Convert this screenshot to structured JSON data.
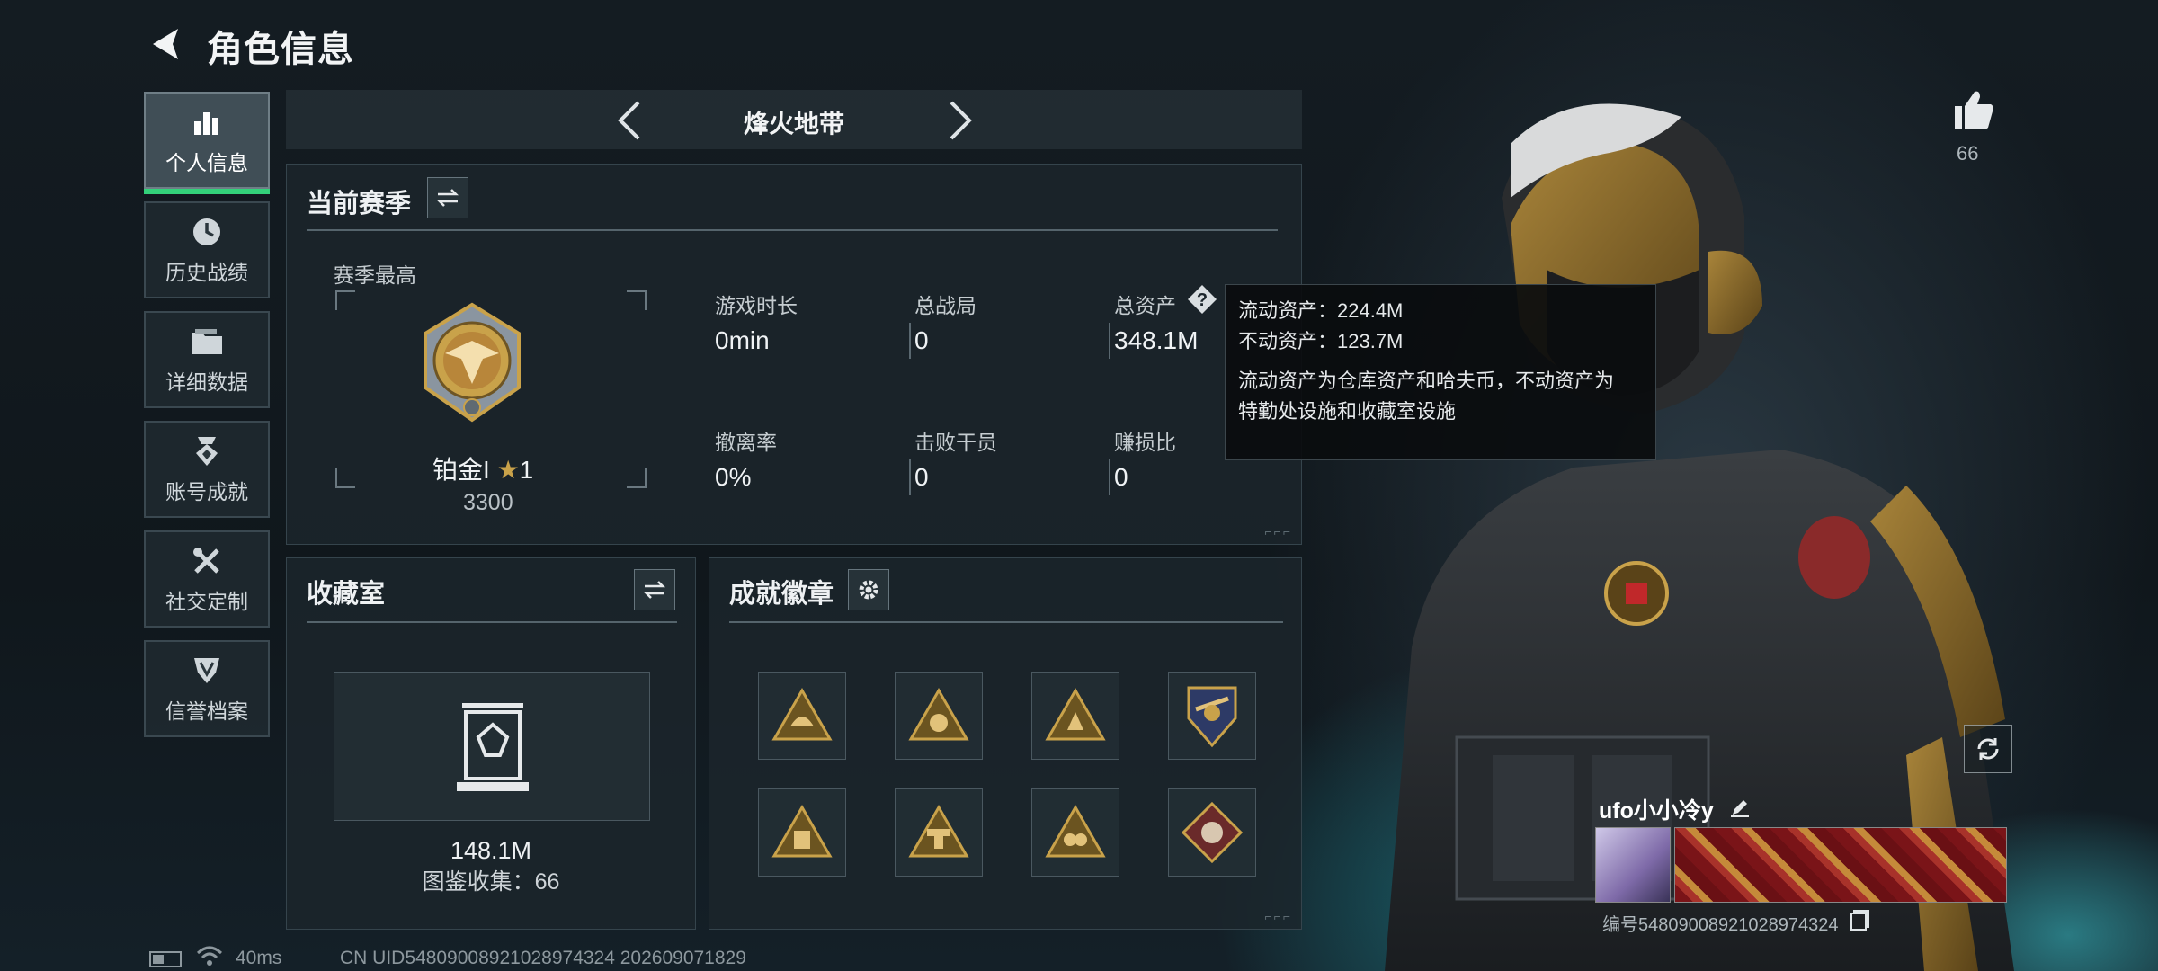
{
  "header": {
    "title": "角色信息"
  },
  "sidebar": {
    "items": [
      {
        "label": "个人信息",
        "icon": "bar-chart-icon",
        "active": true
      },
      {
        "label": "历史战绩",
        "icon": "clock-icon"
      },
      {
        "label": "详细数据",
        "icon": "folder-icon"
      },
      {
        "label": "账号成就",
        "icon": "medal-icon"
      },
      {
        "label": "社交定制",
        "icon": "tools-icon"
      },
      {
        "label": "信誉档案",
        "icon": "shield-icon"
      }
    ]
  },
  "mode": {
    "title": "烽火地带"
  },
  "season": {
    "title": "当前赛季",
    "best_label": "赛季最高",
    "rank_name": "铂金I",
    "rank_stars": "1",
    "rank_score": "3300",
    "stats": [
      {
        "label": "游戏时长",
        "value": "0min"
      },
      {
        "label": "总战局",
        "value": "0"
      },
      {
        "label": "总资产",
        "value": "348.1M"
      },
      {
        "label": "撤离率",
        "value": "0%"
      },
      {
        "label": "击败干员",
        "value": "0"
      },
      {
        "label": "赚损比",
        "value": "0"
      }
    ]
  },
  "tooltip": {
    "line1": "流动资产：224.4M",
    "line2": "不动资产：123.7M",
    "line3": "流动资产为仓库资产和哈夫币，不动资产为",
    "line4": "特勤处设施和收藏室设施"
  },
  "collection": {
    "title": "收藏室",
    "value": "148.1M",
    "count_label": "图鉴收集：66"
  },
  "achievements": {
    "title": "成就徽章",
    "badges": [
      "badge-1",
      "badge-2",
      "badge-3",
      "badge-4",
      "badge-5",
      "badge-6",
      "badge-7",
      "badge-8"
    ]
  },
  "likes": {
    "count": "66"
  },
  "player": {
    "name": "ufo小小冷y",
    "id_label": "编号548090089210289743​24"
  },
  "footer": {
    "ping": "40ms",
    "uid": "CN UID5480900892102897432​4 202609071829"
  },
  "colors": {
    "accent_green": "#33d17a",
    "gold": "#c9a24a"
  }
}
